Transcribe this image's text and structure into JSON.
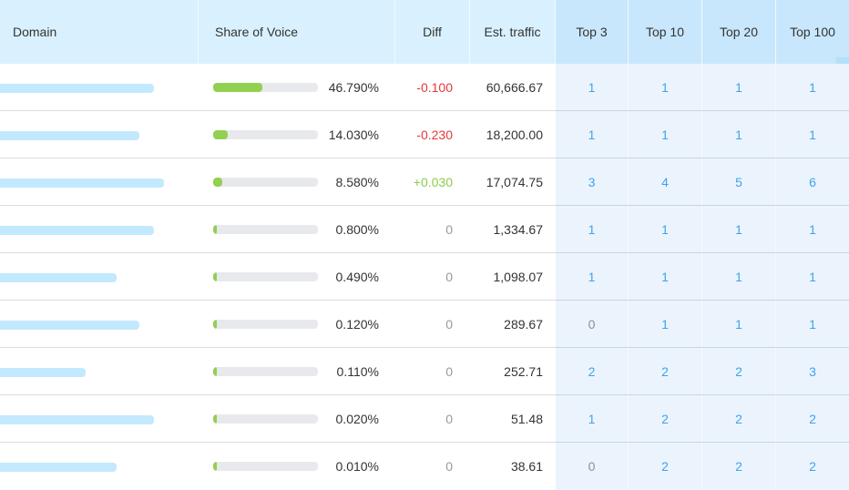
{
  "header": {
    "domain": "Domain",
    "share_of_voice": "Share of Voice",
    "diff": "Diff",
    "est_traffic": "Est. traffic",
    "top3": "Top 3",
    "top10": "Top 10",
    "top20": "Top 20",
    "top100": "Top 100"
  },
  "colors": {
    "header_bg": "#d9f1fe",
    "header_top_bg": "#c8e7fc",
    "domain_bar": "#c2e9fd",
    "sov_fill": "#92d050",
    "sov_track": "#e8e9ed",
    "diff_negative": "#e5373c",
    "diff_positive": "#8ccc4c",
    "top_value": "#3ea3ec"
  },
  "rows": [
    {
      "domain_bar_fraction": 0.94,
      "sov": 46.79,
      "sov_label": "46.790%",
      "diff": "-0.100",
      "diff_type": "neg",
      "traffic": "60,666.67",
      "top3": "1",
      "top10": "1",
      "top20": "1",
      "top100": "1"
    },
    {
      "domain_bar_fraction": 0.85,
      "sov": 14.03,
      "sov_label": "14.030%",
      "diff": "-0.230",
      "diff_type": "neg",
      "traffic": "18,200.00",
      "top3": "1",
      "top10": "1",
      "top20": "1",
      "top100": "1"
    },
    {
      "domain_bar_fraction": 1.0,
      "sov": 8.58,
      "sov_label": "8.580%",
      "diff": "+0.030",
      "diff_type": "pos",
      "traffic": "17,074.75",
      "top3": "3",
      "top10": "4",
      "top20": "5",
      "top100": "6"
    },
    {
      "domain_bar_fraction": 0.94,
      "sov": 0.8,
      "sov_label": "0.800%",
      "diff": "0",
      "diff_type": "zero",
      "traffic": "1,334.67",
      "top3": "1",
      "top10": "1",
      "top20": "1",
      "top100": "1"
    },
    {
      "domain_bar_fraction": 0.71,
      "sov": 0.49,
      "sov_label": "0.490%",
      "diff": "0",
      "diff_type": "zero",
      "traffic": "1,098.07",
      "top3": "1",
      "top10": "1",
      "top20": "1",
      "top100": "1"
    },
    {
      "domain_bar_fraction": 0.85,
      "sov": 0.12,
      "sov_label": "0.120%",
      "diff": "0",
      "diff_type": "zero",
      "traffic": "289.67",
      "top3": "0",
      "top10": "1",
      "top20": "1",
      "top100": "1"
    },
    {
      "domain_bar_fraction": 0.52,
      "sov": 0.11,
      "sov_label": "0.110%",
      "diff": "0",
      "diff_type": "zero",
      "traffic": "252.71",
      "top3": "2",
      "top10": "2",
      "top20": "2",
      "top100": "3"
    },
    {
      "domain_bar_fraction": 0.94,
      "sov": 0.02,
      "sov_label": "0.020%",
      "diff": "0",
      "diff_type": "zero",
      "traffic": "51.48",
      "top3": "1",
      "top10": "2",
      "top20": "2",
      "top100": "2"
    },
    {
      "domain_bar_fraction": 0.71,
      "sov": 0.01,
      "sov_label": "0.010%",
      "diff": "0",
      "diff_type": "zero",
      "traffic": "38.61",
      "top3": "0",
      "top10": "2",
      "top20": "2",
      "top100": "2"
    }
  ]
}
